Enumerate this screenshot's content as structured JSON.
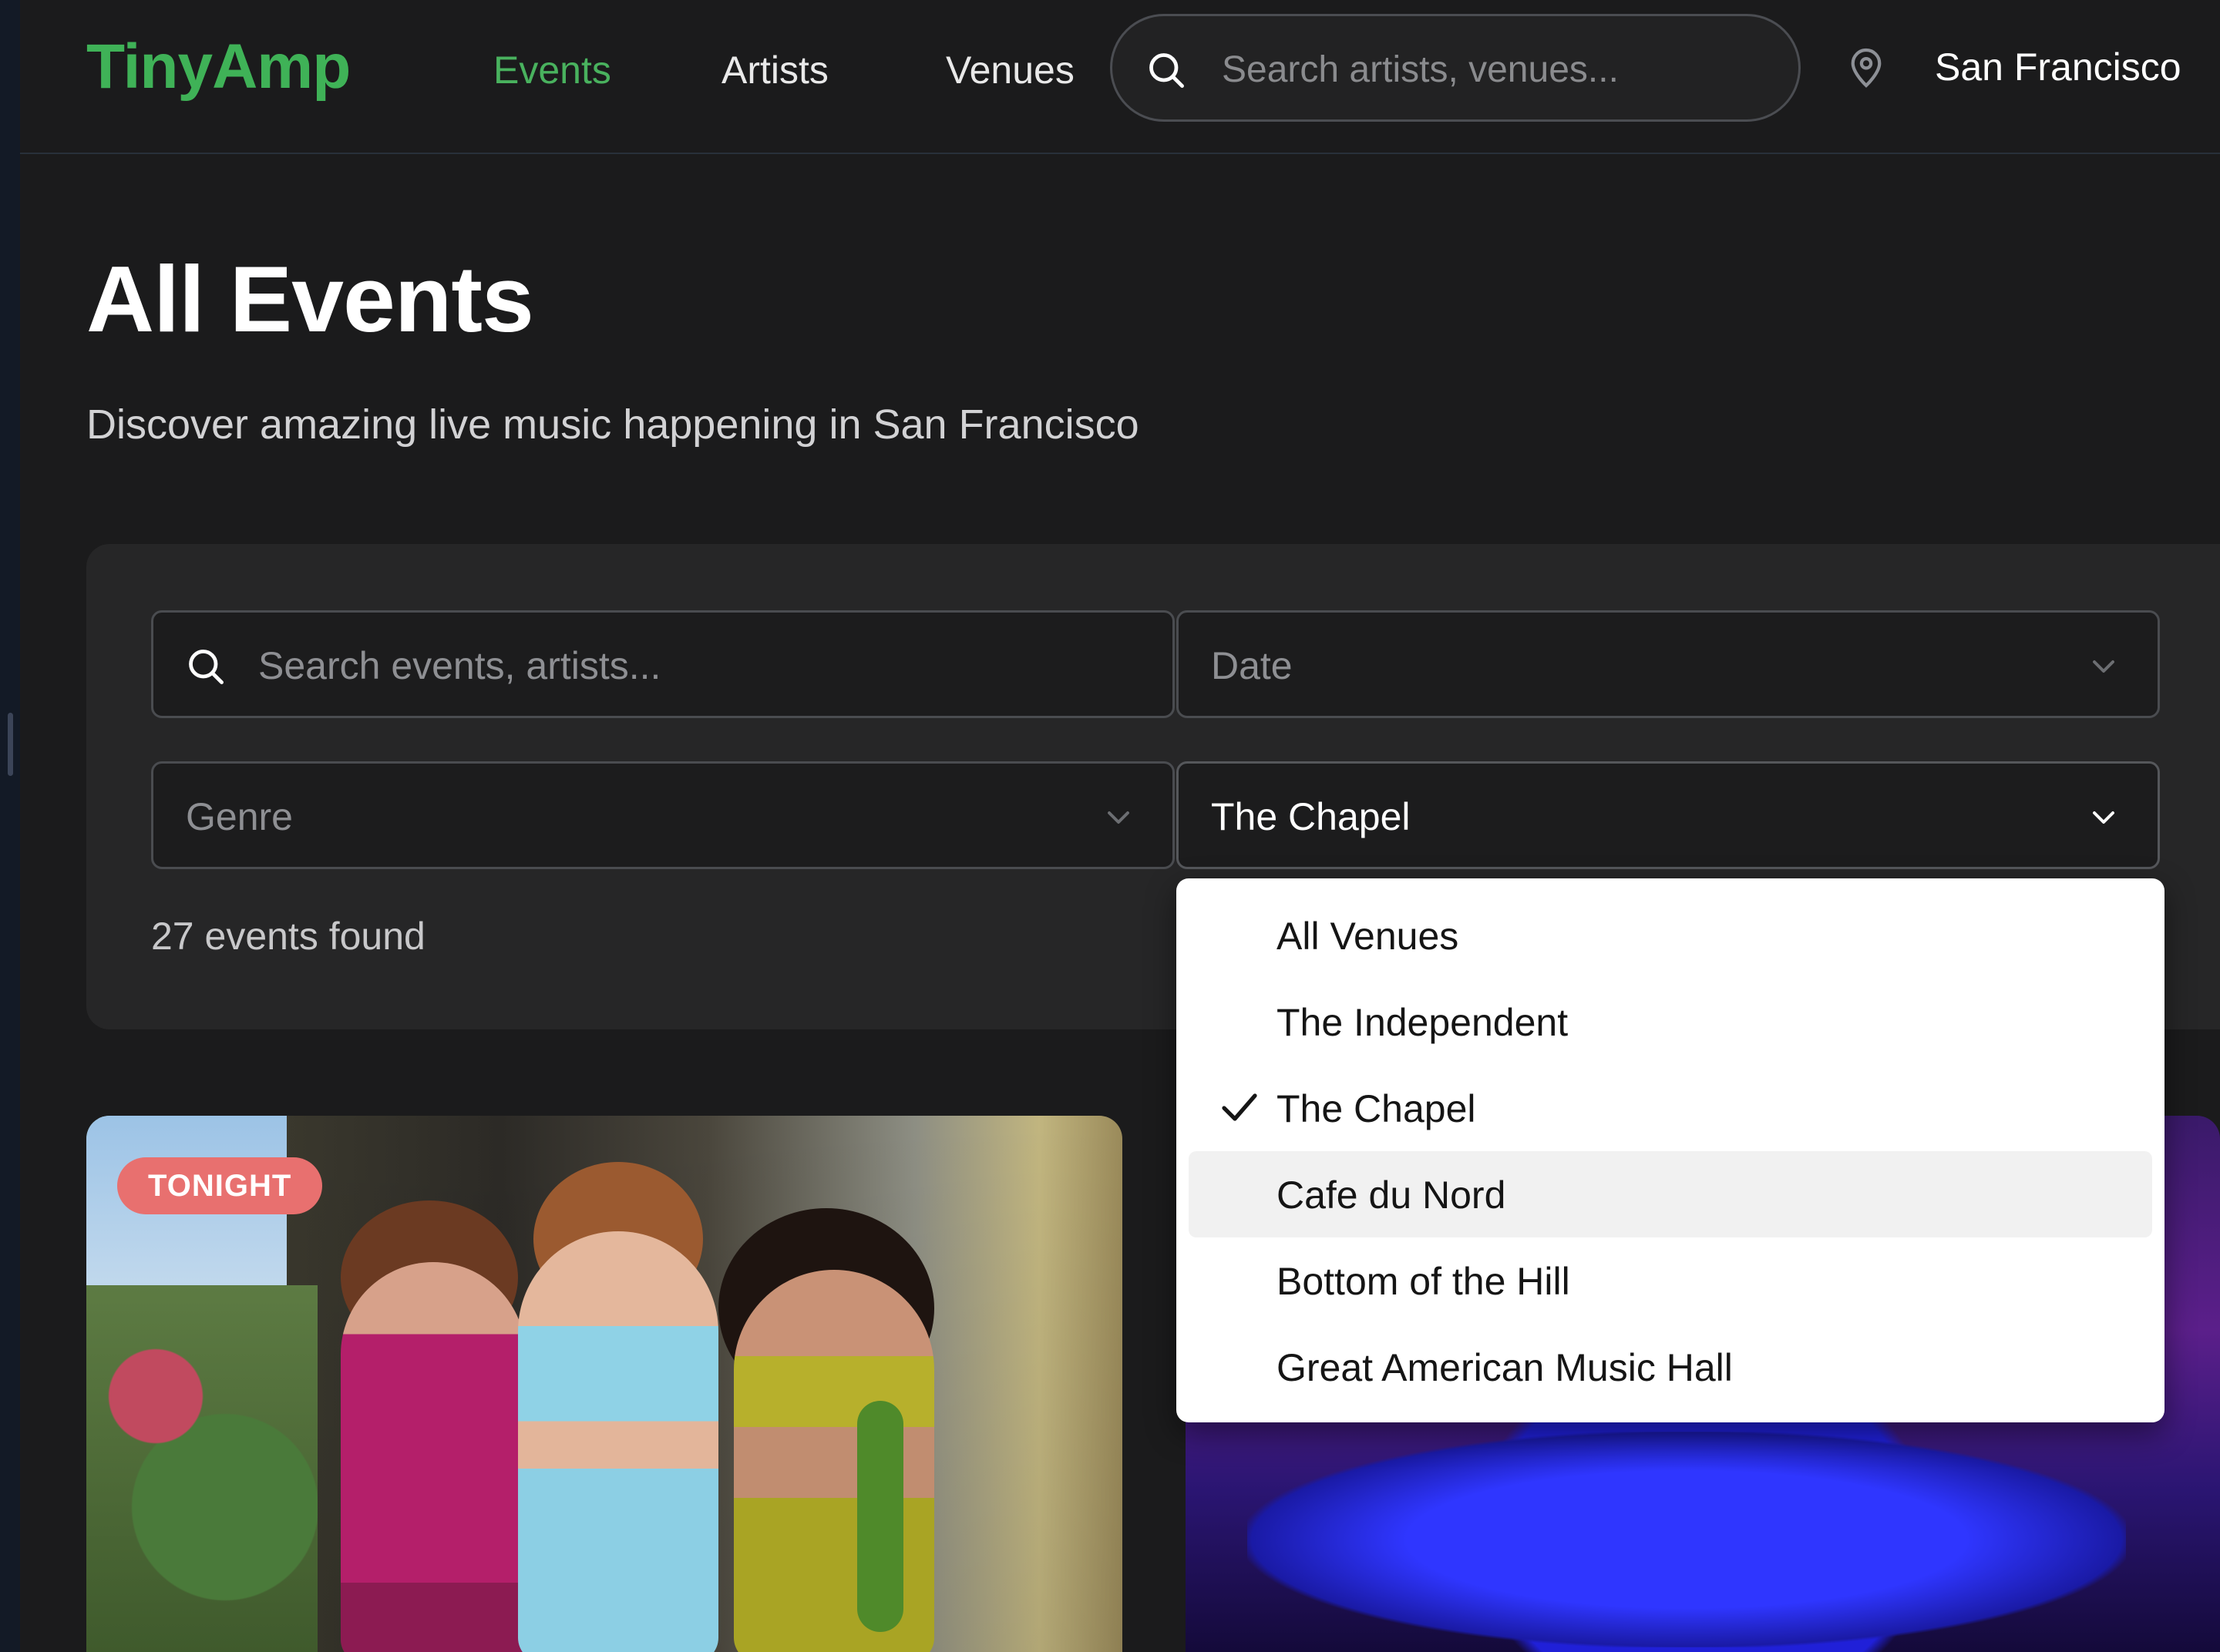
{
  "colors": {
    "brand": "#3fb257",
    "background": "#1b1b1c",
    "panel": "#262627",
    "badge": "#e8706f"
  },
  "header": {
    "logo": "TinyAmp",
    "nav": [
      {
        "label": "Events",
        "active": true
      },
      {
        "label": "Artists",
        "active": false
      },
      {
        "label": "Venues",
        "active": false
      }
    ],
    "search_placeholder": "Search artists, venues...",
    "search_icon": "search-icon",
    "location_icon": "map-pin-icon",
    "city": "San Francisco"
  },
  "main": {
    "title": "All Events",
    "subtitle": "Discover amazing live music happening in San Francisco"
  },
  "filters": {
    "search_placeholder": "Search events, artists...",
    "date_placeholder": "Date",
    "genre_placeholder": "Genre",
    "venue_selected": "The Chapel",
    "results_count": "27 events found"
  },
  "venue_dropdown": {
    "options": [
      {
        "label": "All Venues",
        "selected": false,
        "hovered": false
      },
      {
        "label": "The Independent",
        "selected": false,
        "hovered": false
      },
      {
        "label": "The Chapel",
        "selected": true,
        "hovered": false
      },
      {
        "label": "Cafe du Nord",
        "selected": false,
        "hovered": true
      },
      {
        "label": "Bottom of the Hill",
        "selected": false,
        "hovered": false
      },
      {
        "label": "Great American Music Hall",
        "selected": false,
        "hovered": false
      }
    ]
  },
  "cards": [
    {
      "badge": "TONIGHT"
    },
    {
      "badge": ""
    }
  ]
}
